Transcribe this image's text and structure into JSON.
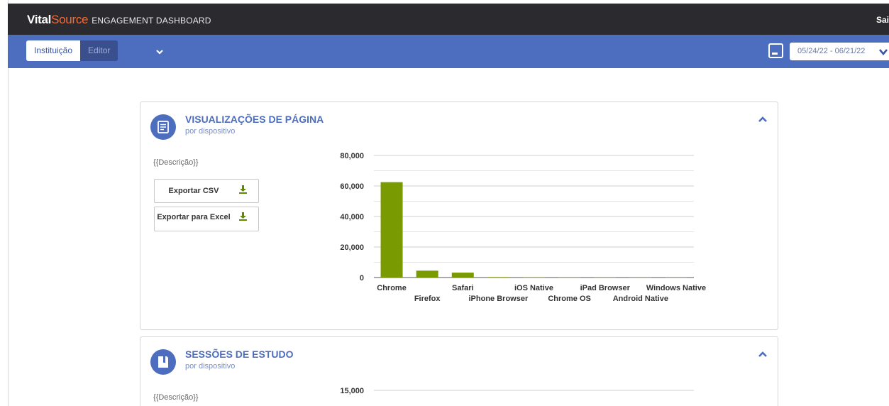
{
  "header": {
    "logo_vital": "Vital",
    "logo_source": "Source",
    "title": "ENGAGEMENT DASHBOARD",
    "signout_label": "Sai"
  },
  "nav": {
    "tabs": [
      {
        "label": "Instituição",
        "active": true
      },
      {
        "label": "Editor",
        "active": false
      }
    ],
    "date_range": "05/24/22 - 06/21/22"
  },
  "cards": [
    {
      "title": "VISUALIZAÇÕES DE PÁGINA",
      "subtitle": "por dispositivo",
      "icon": "document-icon",
      "description": "{{Descrição}}",
      "export_csv_label": "Exportar CSV",
      "export_excel_label": "Exportar para Excel"
    },
    {
      "title": "SESSÕES DE ESTUDO",
      "subtitle": "por dispositivo",
      "icon": "book-icon",
      "description": "{{Descrição}}"
    }
  ],
  "colors": {
    "accent": "#4d6dbe",
    "topbar": "#2b2a2f",
    "bar": "#7a9a01",
    "brand_orange": "#f26b3a"
  },
  "chart_data": [
    {
      "type": "bar",
      "categories": [
        "Chrome",
        "Firefox",
        "Safari",
        "iPhone Browser",
        "iOS Native",
        "Chrome OS",
        "iPad Browser",
        "Android Native",
        "Windows Native"
      ],
      "values": [
        62500,
        4500,
        3200,
        300,
        100,
        50,
        50,
        30,
        20
      ],
      "ylim": [
        0,
        80000
      ],
      "yticks": [
        0,
        20000,
        40000,
        60000,
        80000
      ],
      "ytick_labels": [
        "0",
        "20,000",
        "40,000",
        "60,000",
        "80,000"
      ],
      "grid": true
    },
    {
      "type": "bar",
      "categories": [],
      "values": [],
      "ylim": [
        0,
        15000
      ],
      "yticks": [
        15000
      ],
      "ytick_labels": [
        "15,000"
      ],
      "grid": true
    }
  ]
}
